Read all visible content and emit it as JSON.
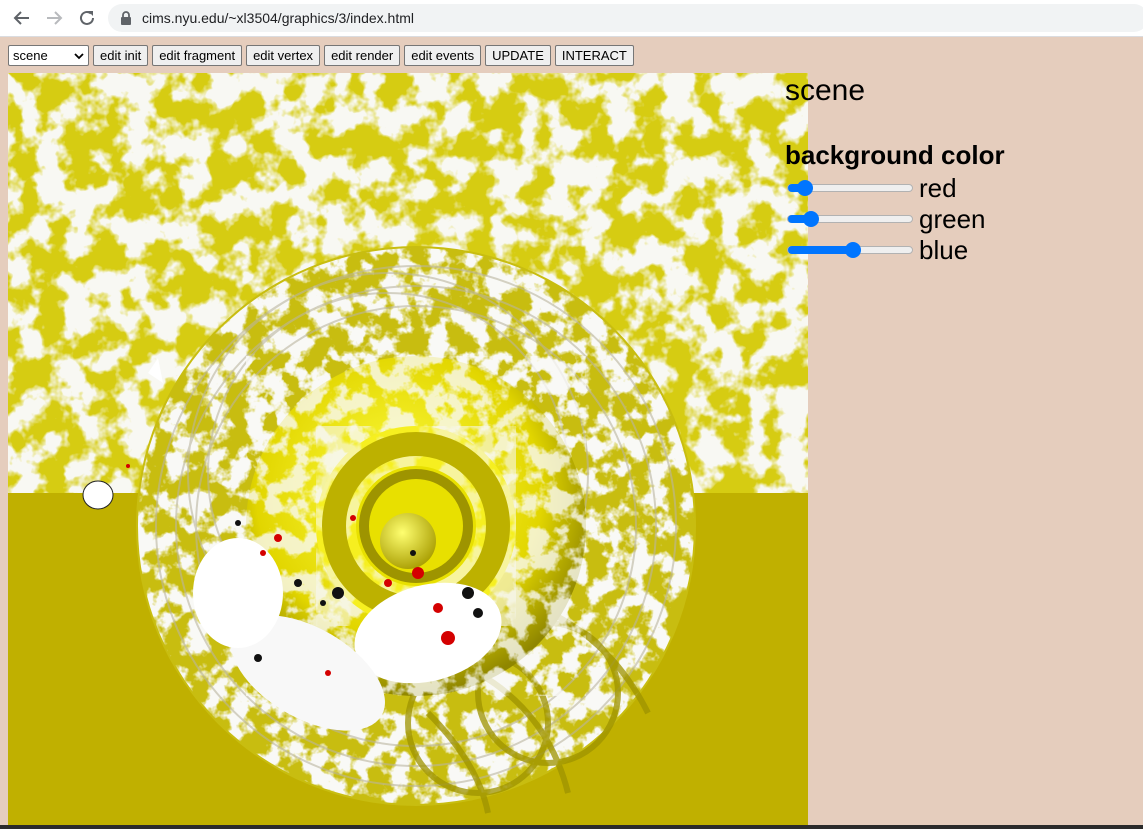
{
  "browser": {
    "url": "cims.nyu.edu/~xl3504/graphics/3/index.html"
  },
  "toolbar": {
    "scene_select_value": "scene",
    "buttons": [
      "edit init",
      "edit fragment",
      "edit vertex",
      "edit render",
      "edit events",
      "UPDATE",
      "INTERACT"
    ]
  },
  "panel": {
    "title": "scene",
    "section_title": "background color",
    "sliders": [
      {
        "label": "red",
        "value": 0.08
      },
      {
        "label": "green",
        "value": 0.14
      },
      {
        "label": "blue",
        "value": 0.52
      }
    ]
  },
  "colors": {
    "page_background": "#e5cdbd",
    "slider_accent": "#0075ff",
    "canvas_yellow": "#c8b400",
    "canvas_white": "#f0f0ea"
  }
}
